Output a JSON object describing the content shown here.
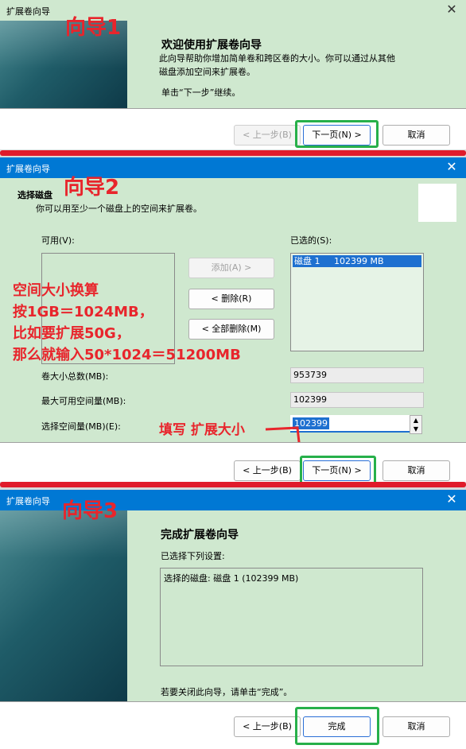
{
  "wizard1": {
    "title": "扩展卷向导",
    "badge": "向导1",
    "heading": "欢迎使用扩展卷向导",
    "desc_line1": "此向导帮助你增加简单卷和跨区卷的大小。你可以通过从其他",
    "desc_line2": "磁盘添加空间来扩展卷。",
    "instruction": "单击“下一步”继续。",
    "back_label": "< 上一步(B)",
    "next_label": "下一页(N) >",
    "cancel_label": "取消"
  },
  "wizard2": {
    "title": "扩展卷向导",
    "badge": "向导2",
    "header_title": "选择磁盘",
    "header_desc": "你可以用至少一个磁盘上的空间来扩展卷。",
    "available_label": "可用(V):",
    "selected_label": "已选的(S):",
    "selected_items": [
      "磁盘 1     102399 MB"
    ],
    "add_label": "添加(A) >",
    "remove_label": "< 删除(R)",
    "remove_all_label": "< 全部删除(M)",
    "total_size_label": "卷大小总数(MB):",
    "total_size_value": "953739",
    "max_space_label": "最大可用空间量(MB):",
    "max_space_value": "102399",
    "select_space_label": "选择空间量(MB)(E):",
    "select_space_value": "102399",
    "back_label": "< 上一步(B)",
    "next_label": "下一页(N) >",
    "cancel_label": "取消"
  },
  "annotation": {
    "line1": "空间大小换算",
    "line2": "按1GB＝1024MB，",
    "line3": "比如要扩展50G，",
    "line4": "那么就输入50*1024＝51200MB",
    "fill_hint": "填写 扩展大小"
  },
  "wizard3": {
    "title": "扩展卷向导",
    "badge": "向导3",
    "heading": "完成扩展卷向导",
    "selected_settings_label": "已选择下列设置:",
    "summary_text": "选择的磁盘: 磁盘 1 (102399 MB)",
    "close_hint": "若要关闭此向导，请单击“完成”。",
    "back_label": "< 上一步(B)",
    "finish_label": "完成",
    "cancel_label": "取消"
  },
  "colors": {
    "accent_red": "#e8252c",
    "highlight_green": "#27b04a",
    "titlebar_blue": "#0078d4",
    "panel_green": "#cfe8cf"
  }
}
